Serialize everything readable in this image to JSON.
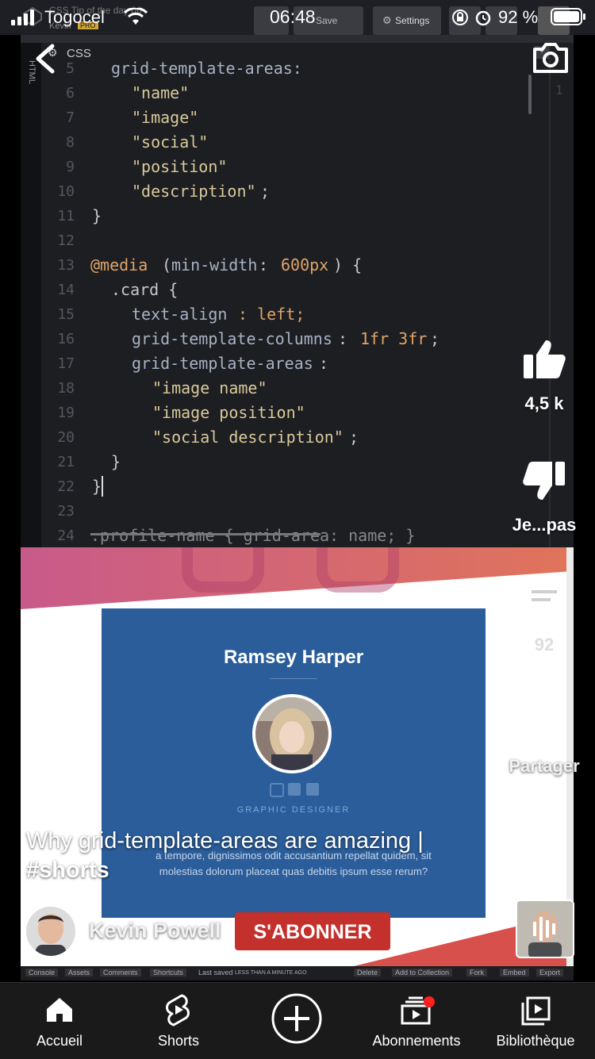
{
  "status_bar": {
    "carrier": "Togocel",
    "time": "06:48",
    "battery_percent": "92 %"
  },
  "codepen": {
    "title_fragment": "CSS Tip of the day 06",
    "author": "Kevin",
    "badge": "PRO",
    "save_label": "Save",
    "settings_label": "Settings",
    "side_tab": "HTML",
    "pane_label": "CSS",
    "right_gutter_line": "1",
    "bottom_bar": {
      "console": "Console",
      "assets": "Assets",
      "comments": "Comments",
      "shortcuts": "Shortcuts",
      "last_saved": "Last saved",
      "last_saved_time": "LESS THAN A MINUTE AGO",
      "delete": "Delete",
      "add_to_collection": "Add to Collection",
      "fork": "Fork",
      "embed": "Embed",
      "export": "Export"
    }
  },
  "code": {
    "line_numbers": [
      "5",
      "6",
      "7",
      "8",
      "9",
      "10",
      "11",
      "12",
      "13",
      "14",
      "15",
      "16",
      "17",
      "18",
      "19",
      "20",
      "21",
      "22",
      "23",
      "24"
    ],
    "l5": "grid-template-areas:",
    "l6": "\"name\"",
    "l7": "\"image\"",
    "l8": "\"social\"",
    "l9": "\"position\"",
    "l10": "\"description\"",
    "l10_end": ";",
    "l11": "}",
    "l13_at": "@media",
    "l13_open": "(",
    "l13_prop": "min-width",
    "l13_colon": ": ",
    "l13_num": "600px",
    "l13_close": ") {",
    "l14": ".card {",
    "l15_prop": "text-align",
    "l15_val": ": left;",
    "l16_prop": "grid-template-columns",
    "l16_colon": ": ",
    "l16_val": "1fr 3fr",
    "l16_end": ";",
    "l17_prop": "grid-template-areas",
    "l17_colon": ":",
    "l18": "\"image name\"",
    "l19": "\"image position\"",
    "l20": "\"social description\"",
    "l20_end": ";",
    "l21": "}",
    "l22": "}",
    "l24": ".profile-name { grid-area: name; }"
  },
  "preview": {
    "name": "Ramsey Harper",
    "role": "GRAPHIC DESIGNER",
    "description_line1": "a tempore, dignissimos odit accusantium repellat quidem, sit",
    "description_line2": "molestias dolorum placeat quas debitis ipsum esse rerum?"
  },
  "short": {
    "title_line1": "Why grid-template-areas are amazing |",
    "title_line2": "#shorts",
    "channel_name": "Kevin Powell",
    "subscribe_label": "S'ABONNER",
    "likes": "4,5 k",
    "dislike_label": "Je...pas",
    "comments_count": "92",
    "share_label": "Partager",
    "more_label": "•••"
  },
  "nav": {
    "home": "Accueil",
    "shorts": "Shorts",
    "subscriptions": "Abonnements",
    "library": "Bibliothèque"
  },
  "colors": {
    "subscribe_red": "#c4302b",
    "card_blue": "#2a5d9a",
    "code_string": "#d9c99b",
    "code_number": "#e0a469"
  }
}
